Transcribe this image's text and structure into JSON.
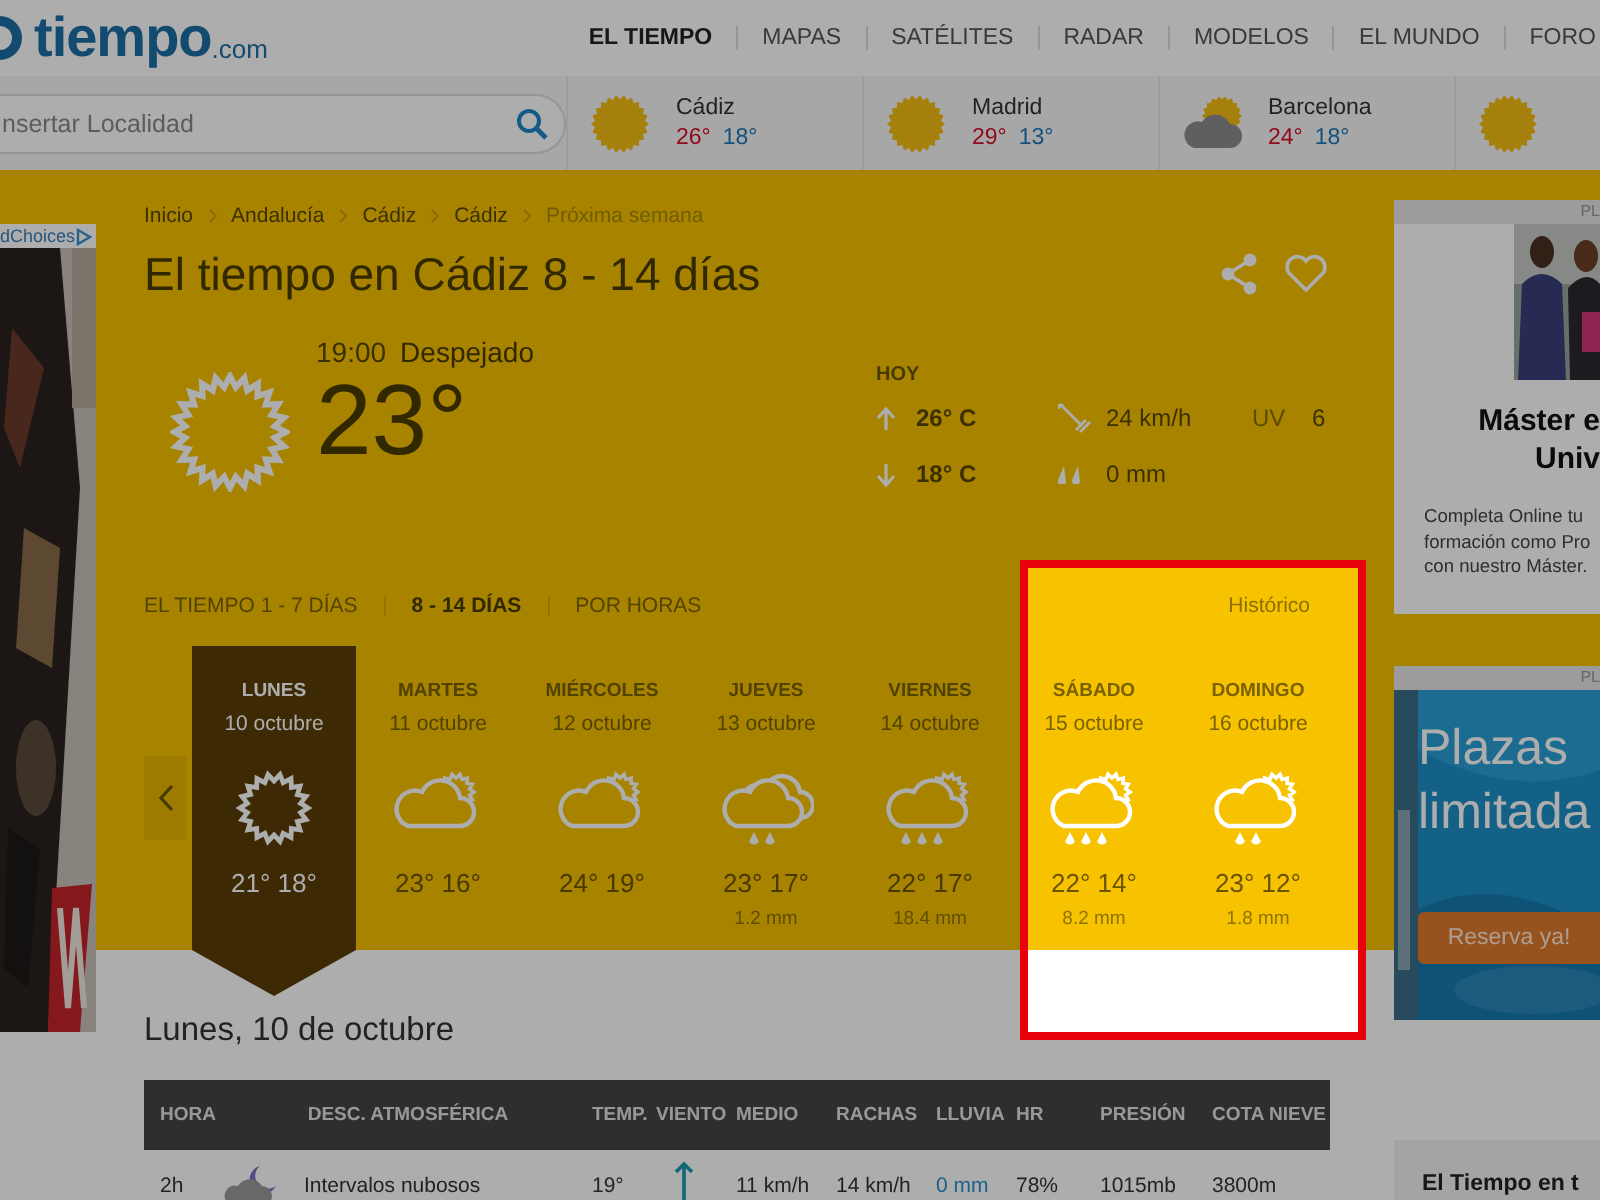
{
  "header": {
    "logo": {
      "name": "tiempo",
      "suffix": ".com"
    },
    "nav": [
      {
        "label": "EL TIEMPO",
        "selected": true
      },
      {
        "label": "MAPAS",
        "selected": false
      },
      {
        "label": "SATÉLITES",
        "selected": false
      },
      {
        "label": "RADAR",
        "selected": false
      },
      {
        "label": "MODELOS",
        "selected": false
      },
      {
        "label": "EL MUNDO",
        "selected": false
      },
      {
        "label": "FORO",
        "selected": false
      }
    ]
  },
  "search": {
    "placeholder": "nsertar Localidad"
  },
  "cities": [
    {
      "name": "Cádiz",
      "max": "26°",
      "min": "18°",
      "kind": "sun"
    },
    {
      "name": "Madrid",
      "max": "29°",
      "min": "13°",
      "kind": "sun"
    },
    {
      "name": "Barcelona",
      "max": "24°",
      "min": "18°",
      "kind": "cloudsun"
    },
    {
      "kind": "sun"
    }
  ],
  "left_ad": {
    "label": "dChoices"
  },
  "breadcrumb": [
    {
      "label": "Inicio",
      "current": false
    },
    {
      "label": "Andalucía",
      "current": false
    },
    {
      "label": "Cádiz",
      "current": false
    },
    {
      "label": "Cádiz",
      "current": false
    },
    {
      "label": "Próxima semana",
      "current": true
    }
  ],
  "title": "El tiempo en Cádiz 8 - 14 días",
  "current": {
    "time": "19:00",
    "condition": "Despejado",
    "temp": "23°",
    "today_label": "HOY",
    "max": "26° C",
    "min": "18° C",
    "wind": "24 km/h",
    "rain": "0 mm",
    "uv_label": "UV",
    "uv": "6"
  },
  "tabs": [
    {
      "label": "EL TIEMPO 1 - 7 DÍAS",
      "selected": false
    },
    {
      "label": "8 - 14 DÍAS",
      "selected": true
    },
    {
      "label": "POR HORAS",
      "selected": false
    }
  ],
  "history_link": "Histórico",
  "days": [
    {
      "name": "LUNES",
      "date": "10 octubre",
      "kind": "sun",
      "temps": "21° 18°",
      "selected": true,
      "highlighted": false
    },
    {
      "name": "MARTES",
      "date": "11 octubre",
      "kind": "cloudsun",
      "temps": "23° 16°",
      "selected": false,
      "highlighted": false
    },
    {
      "name": "MIÉRCOLES",
      "date": "12 octubre",
      "kind": "cloudsun",
      "temps": "24° 19°",
      "selected": false,
      "highlighted": false
    },
    {
      "name": "JUEVES",
      "date": "13 octubre",
      "kind": "rain",
      "temps": "23° 17°",
      "rain": "1.2 mm",
      "selected": false,
      "highlighted": false
    },
    {
      "name": "VIERNES",
      "date": "14 octubre",
      "kind": "showers",
      "temps": "22° 17°",
      "rain": "18.4 mm",
      "selected": false,
      "highlighted": false
    },
    {
      "name": "SÁBADO",
      "date": "15 octubre",
      "kind": "showers",
      "temps": "22° 14°",
      "rain": "8.2 mm",
      "selected": false,
      "highlighted": true
    },
    {
      "name": "DOMINGO",
      "date": "16 octubre",
      "kind": "drizzle",
      "temps": "23° 12°",
      "rain": "1.8 mm",
      "selected": false,
      "highlighted": true
    }
  ],
  "day_heading": "Lunes, 10 de octubre",
  "table": {
    "columns": [
      "HORA",
      "DESC. ATMOSFÉRICA",
      "TEMP.",
      "VIENTO",
      "MEDIO",
      "RACHAS",
      "LLUVIA",
      "HR",
      "PRESIÓN",
      "COTA NIEVE"
    ],
    "rows": [
      {
        "hour": "2h",
        "description": "Intervalos nubosos",
        "temp": "19°",
        "average": "11 km/h",
        "gusts": "14 km/h",
        "rain": "0 mm",
        "humidity": "78%",
        "pressure": "1015mb",
        "snow_level": "3800m"
      }
    ]
  },
  "right_ads": [
    {
      "kind": "text-ad",
      "label": "PL",
      "title": "Máster e\nUniv",
      "body": "Completa Online tu\nformación como Pro\ncon nuestro Máster."
    },
    {
      "kind": "image-ad",
      "label": "PL",
      "headline": "Plazas\nlimitada",
      "button": "Reserva ya!"
    }
  ],
  "side_card": {
    "title": "El Tiempo en t"
  }
}
